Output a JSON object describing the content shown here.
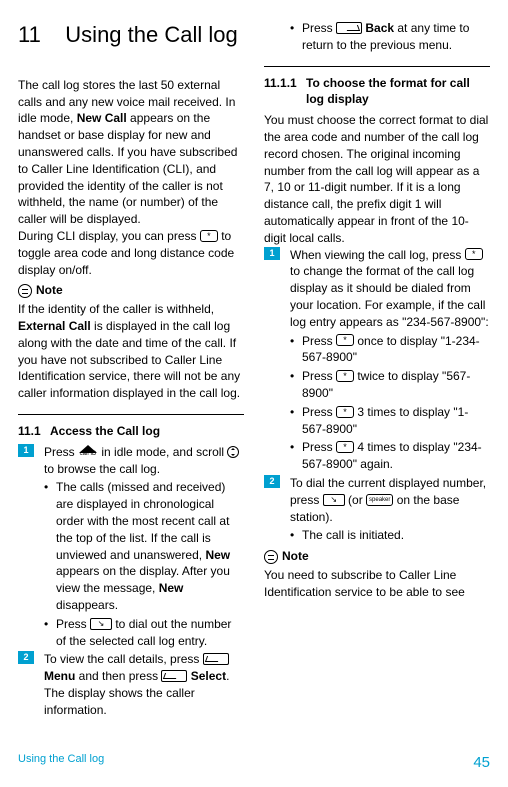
{
  "chapter": {
    "num": "11",
    "title": "Using the Call log"
  },
  "intro": {
    "p1a": "The call log stores the last 50 external calls and any new voice mail received. In idle mode, ",
    "p1b": "New Call",
    "p1c": " appears on the handset or base display for new and unanswered calls. If you have subscribed to Caller Line Identification (CLI), and provided the identity of the caller is not withheld, the name (or number) of the caller will be displayed.",
    "p2a": "During CLI display, you can press ",
    "p2b": " to toggle area code and long distance code display on/off."
  },
  "note1": {
    "label": "Note",
    "t1": "If the identity of the caller is withheld, ",
    "t2": "External Call",
    "t3": " is displayed in the call log along with the date and time of the call. If you have not subscribed to Caller Line Identification service, there will not be any caller information displayed in the call log."
  },
  "sec11_1": {
    "num": "11.1",
    "title": "Access the Call log",
    "step1a": "Press ",
    "step1b": " in idle mode, and scroll ",
    "step1c": " to browse the call log.",
    "b1a": "The calls (missed and received) are displayed in chronological order with the most recent call at the top of the list. If the call is unviewed and unanswered, ",
    "b1b": "New",
    "b1c": " appears on the display. After you view the message, ",
    "b1d": "New",
    "b1e": " disappears.",
    "b2a": "Press ",
    "b2b": " to dial out the number of the selected call log entry.",
    "step2a": "To view the call details, press ",
    "step2b": "Menu",
    "step2c": " and then press ",
    "step2d": "Select",
    "step2e": ". The display shows the caller information.",
    "b3a": "Press ",
    "b3b": "Back",
    "b3c": " at any time to return to the previous menu."
  },
  "sec11_1_1": {
    "num": "11.1.1",
    "title": "To choose the format for call log display",
    "intro": "You must choose the correct format to dial the area code and number of the call log record chosen. The original incoming number from the call log will appear as a 7, 10 or 11-digit number. If it is a long distance call, the prefix digit 1 will automatically appear in front of the 10-digit local calls.",
    "step1a": "When viewing the call log, press ",
    "step1b": " to change the format of the call log display as it should be dialed from your location. For example, if the call log entry appears as \"234-567-8900\":",
    "b1a": "Press ",
    "b1b": " once to display \"1-234-567-8900\"",
    "b2a": "Press ",
    "b2b": " twice to display \"567-8900\"",
    "b3a": "Press ",
    "b3b": " 3 times to display \"1-567-8900\"",
    "b4a": "Press ",
    "b4b": " 4 times to display \"234-567-8900\" again.",
    "step2a": "To dial the current displayed number, press ",
    "step2b": " (or ",
    "step2c": " on the base station).",
    "b5": "The call is initiated."
  },
  "note2": {
    "label": "Note",
    "t": "You need to subscribe to Caller Line Identification service to be able to see"
  },
  "footer": {
    "title": "Using the Call log",
    "page": "45"
  },
  "keys": {
    "star": "*",
    "talk": "⌕",
    "speaker": "speaker",
    "callid": "call ID"
  }
}
